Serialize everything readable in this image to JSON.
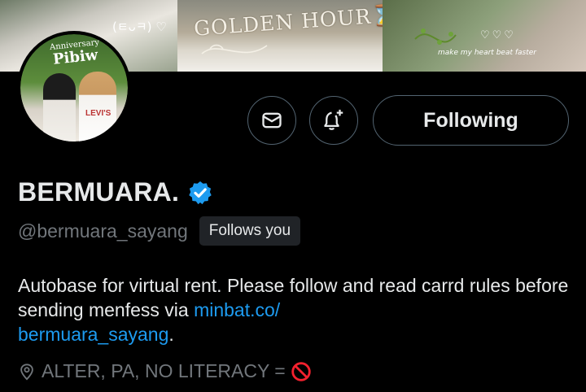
{
  "banner": {
    "emote_text": "(ㅌᴗㅋ) ♡",
    "golden_text": "GOLDEN HOUR⌛",
    "heartbeat_text": "make my heart beat faster",
    "hearts_text": "♡♡♡"
  },
  "avatar": {
    "overlay_small": "Anniversary",
    "overlay_name": "Pibiw",
    "shirt_text": "LEVI'S"
  },
  "profile": {
    "display_name": "BERMUARA.",
    "handle": "@bermuara_sayang",
    "follows_you": "Follows you",
    "bio_text": "Autobase for virtual rent. Please follow and read carrd rules before sending menfess via ",
    "bio_link_line1": "minbat.co/",
    "bio_link_line2": "bermuara_sayang",
    "bio_end": ".",
    "location": "ALTER, PA, NO LITERACY ="
  },
  "actions": {
    "following_label": "Following",
    "message_icon": "envelope-icon",
    "notify_icon": "bell-plus-icon"
  },
  "colors": {
    "accent": "#1d9bf0",
    "secondary_text": "#71767b",
    "border": "#536471",
    "verified": "#1d9bf0",
    "no_sign": "#f4212e"
  }
}
